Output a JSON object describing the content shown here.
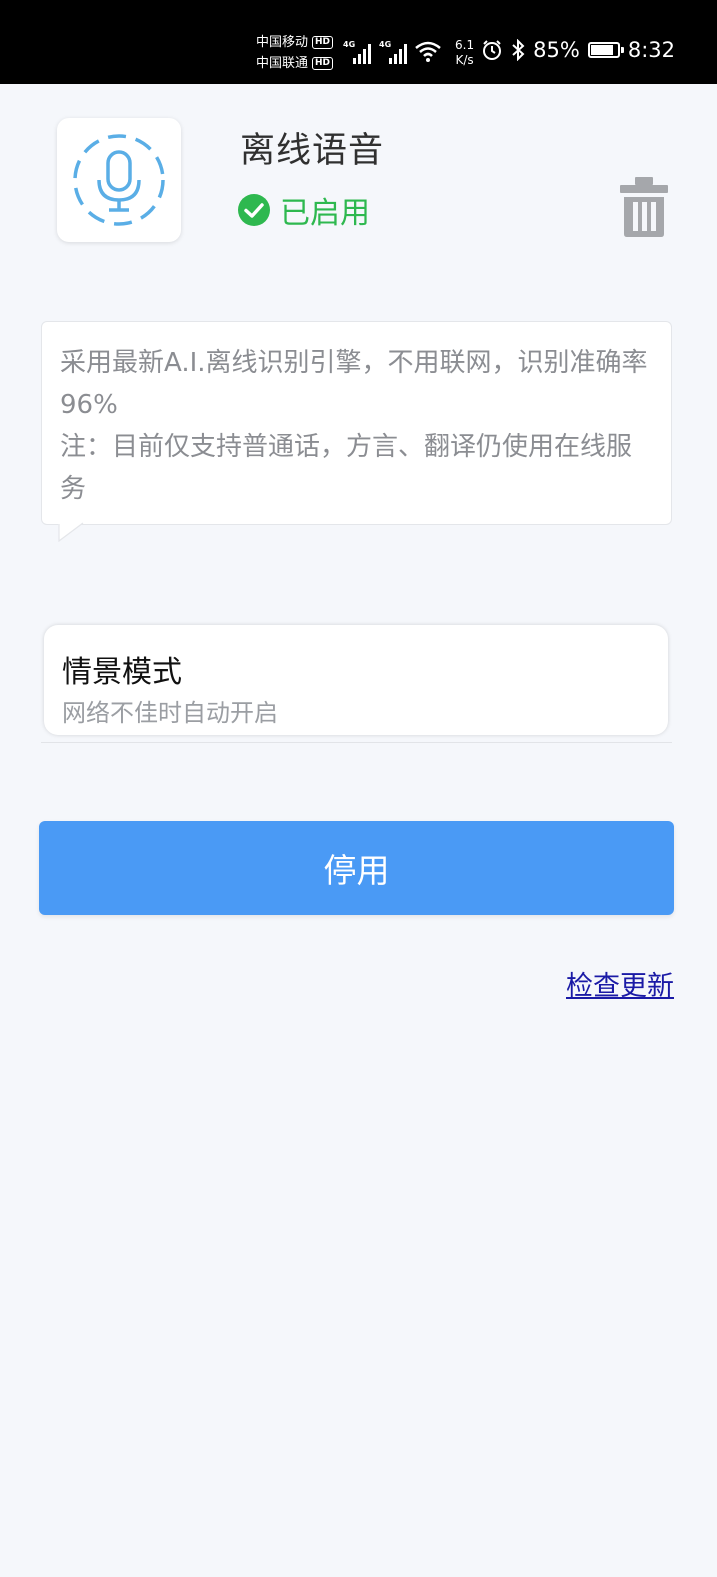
{
  "status_bar": {
    "carrier1": "中国移动",
    "carrier2": "中国联通",
    "hd_label": "HD",
    "network1": "4G",
    "network2": "4G",
    "net_speed_value": "6.1",
    "net_speed_unit": "K/s",
    "battery": "85%",
    "battery_level": 0.85,
    "time": "8:32",
    "icons": [
      "alarm-icon",
      "bluetooth-icon",
      "wifi-icon",
      "battery-icon"
    ]
  },
  "header": {
    "title": "离线语音",
    "status": "已启用",
    "status_color": "#2eb84f",
    "app_icon": "microphone-icon",
    "delete_icon": "trash-icon"
  },
  "description": {
    "line1": "采用最新A.I.离线识别引擎，不用联网，识别准确率96%",
    "line2": "注：目前仅支持普通话，方言、翻译仍使用在线服务"
  },
  "scene_mode": {
    "title": "情景模式",
    "subtitle": "网络不佳时自动开启"
  },
  "actions": {
    "disable_label": "停用",
    "disable_color": "#4a9af5",
    "check_update_label": "检查更新"
  }
}
